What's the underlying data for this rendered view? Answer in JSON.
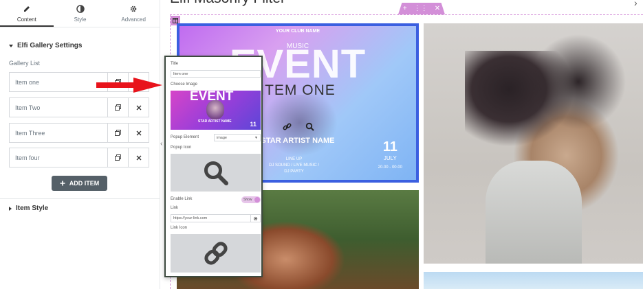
{
  "panel": {
    "tabs": [
      {
        "label": "Content",
        "icon": "pencil-icon"
      },
      {
        "label": "Style",
        "icon": "contrast-icon"
      },
      {
        "label": "Advanced",
        "icon": "gear-icon"
      }
    ],
    "section_title": "Elfi Gallery Settings",
    "gallery_list_label": "Gallery List",
    "items": [
      {
        "label": "Item one"
      },
      {
        "label": "Item Two"
      },
      {
        "label": "Item Three"
      },
      {
        "label": "Item four"
      }
    ],
    "add_item_label": "ADD ITEM",
    "item_style_label": "Item Style"
  },
  "canvas": {
    "page_title": "Elfi Masonry Filter",
    "event": {
      "club": "YOUR CLUB NAME",
      "music": "MUSIC",
      "big": "EVENT",
      "item_title": "ITEM ONE",
      "star": "STAR ARTIST NAME",
      "line1": "LINE UP",
      "line2": "DJ SOUND / LIVE MUSIC /",
      "line3": "DJ PARTY",
      "day": "11",
      "month": "JULY",
      "time": "20.00 - 00.00"
    }
  },
  "popup": {
    "title_label": "Title",
    "title_value": "Item one",
    "choose_image_label": "Choose Image",
    "thumb_big": "EVENT",
    "thumb_star": "STAR ARTIST NAME",
    "thumb_num": "11",
    "popup_element_label": "Popup Element",
    "popup_element_value": "image",
    "popup_icon_label": "Popup Icon",
    "enable_link_label": "Enable Link",
    "enable_link_value": "Show",
    "link_label": "Link",
    "link_placeholder": "https://your-link.com",
    "link_icon_label": "Link Icon"
  },
  "colors": {
    "accent": "#d38fd8",
    "arrow": "#e8131b",
    "button": "#556068",
    "frame": "#3b5fe0"
  }
}
